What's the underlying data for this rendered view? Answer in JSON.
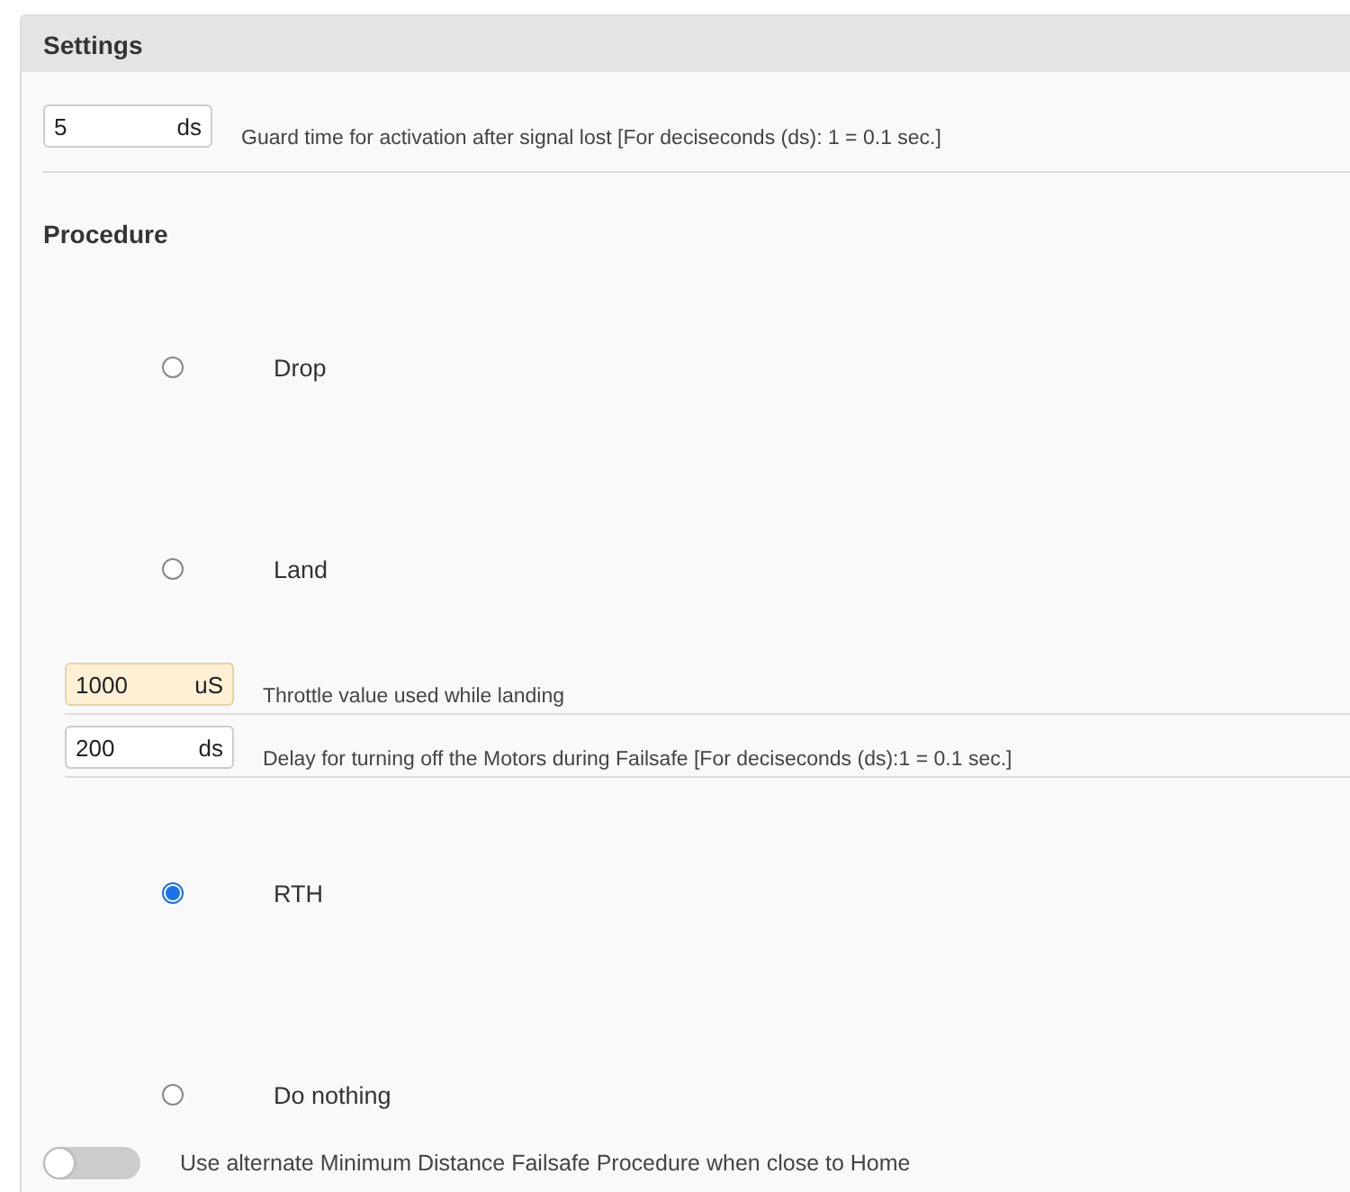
{
  "panel": {
    "title": "Settings"
  },
  "guard": {
    "value": "5",
    "unit": "ds",
    "description": "Guard time for activation after signal lost [For deciseconds (ds): 1 = 0.1 sec.]",
    "highlighted": false
  },
  "procedure": {
    "heading": "Procedure",
    "options": [
      {
        "label": "Drop",
        "selected": false
      },
      {
        "label": "Land",
        "selected": false,
        "fields": [
          {
            "value": "1000",
            "unit": "uS",
            "description": "Throttle value used while landing",
            "highlighted": true
          },
          {
            "value": "200",
            "unit": "ds",
            "description": "Delay for turning off the Motors during Failsafe [For deciseconds (ds):1 = 0.1 sec.]",
            "highlighted": false
          }
        ]
      },
      {
        "label": "RTH",
        "selected": true
      },
      {
        "label": "Do nothing",
        "selected": false
      }
    ]
  },
  "toggle": {
    "on": false,
    "label": "Use alternate Minimum Distance Failsafe Procedure when close to Home"
  }
}
